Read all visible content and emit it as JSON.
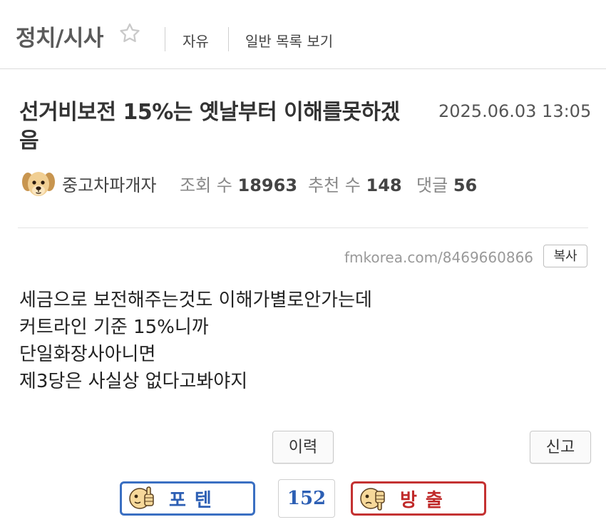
{
  "board": {
    "title": "정치/시사",
    "nav_free": "자유",
    "nav_list": "일반 목록 보기"
  },
  "post": {
    "title_line1": "선거비보전 15%는 옛날부터 이해를못하겠",
    "title_line2": "음",
    "date": "2025.06.03 13:05",
    "author": "중고차파개자",
    "views_label": "조회 수",
    "views": "18963",
    "recommend_label": "추천 수",
    "recommend": "148",
    "comments_label": "댓글",
    "comments": "56",
    "url": "fmkorea.com/8469660866",
    "copy_label": "복사",
    "body": [
      "세금으로 보전해주는것도 이해가별로안가는데",
      "커트라인 기준 15%니까",
      "단일화장사아니면",
      "제3당은 사실상 없다고봐야지"
    ]
  },
  "actions": {
    "history_label": "이력",
    "report_label": "신고"
  },
  "vote": {
    "up_label": "포텐",
    "count": "152",
    "down_label": "방출",
    "up_color": "#3a6fc2",
    "down_color": "#c43232"
  },
  "icons": {
    "star": "star-outline-icon",
    "avatar": "puppy-avatar",
    "up": "thumbs-up-face-icon",
    "down": "thumbs-down-face-icon"
  }
}
